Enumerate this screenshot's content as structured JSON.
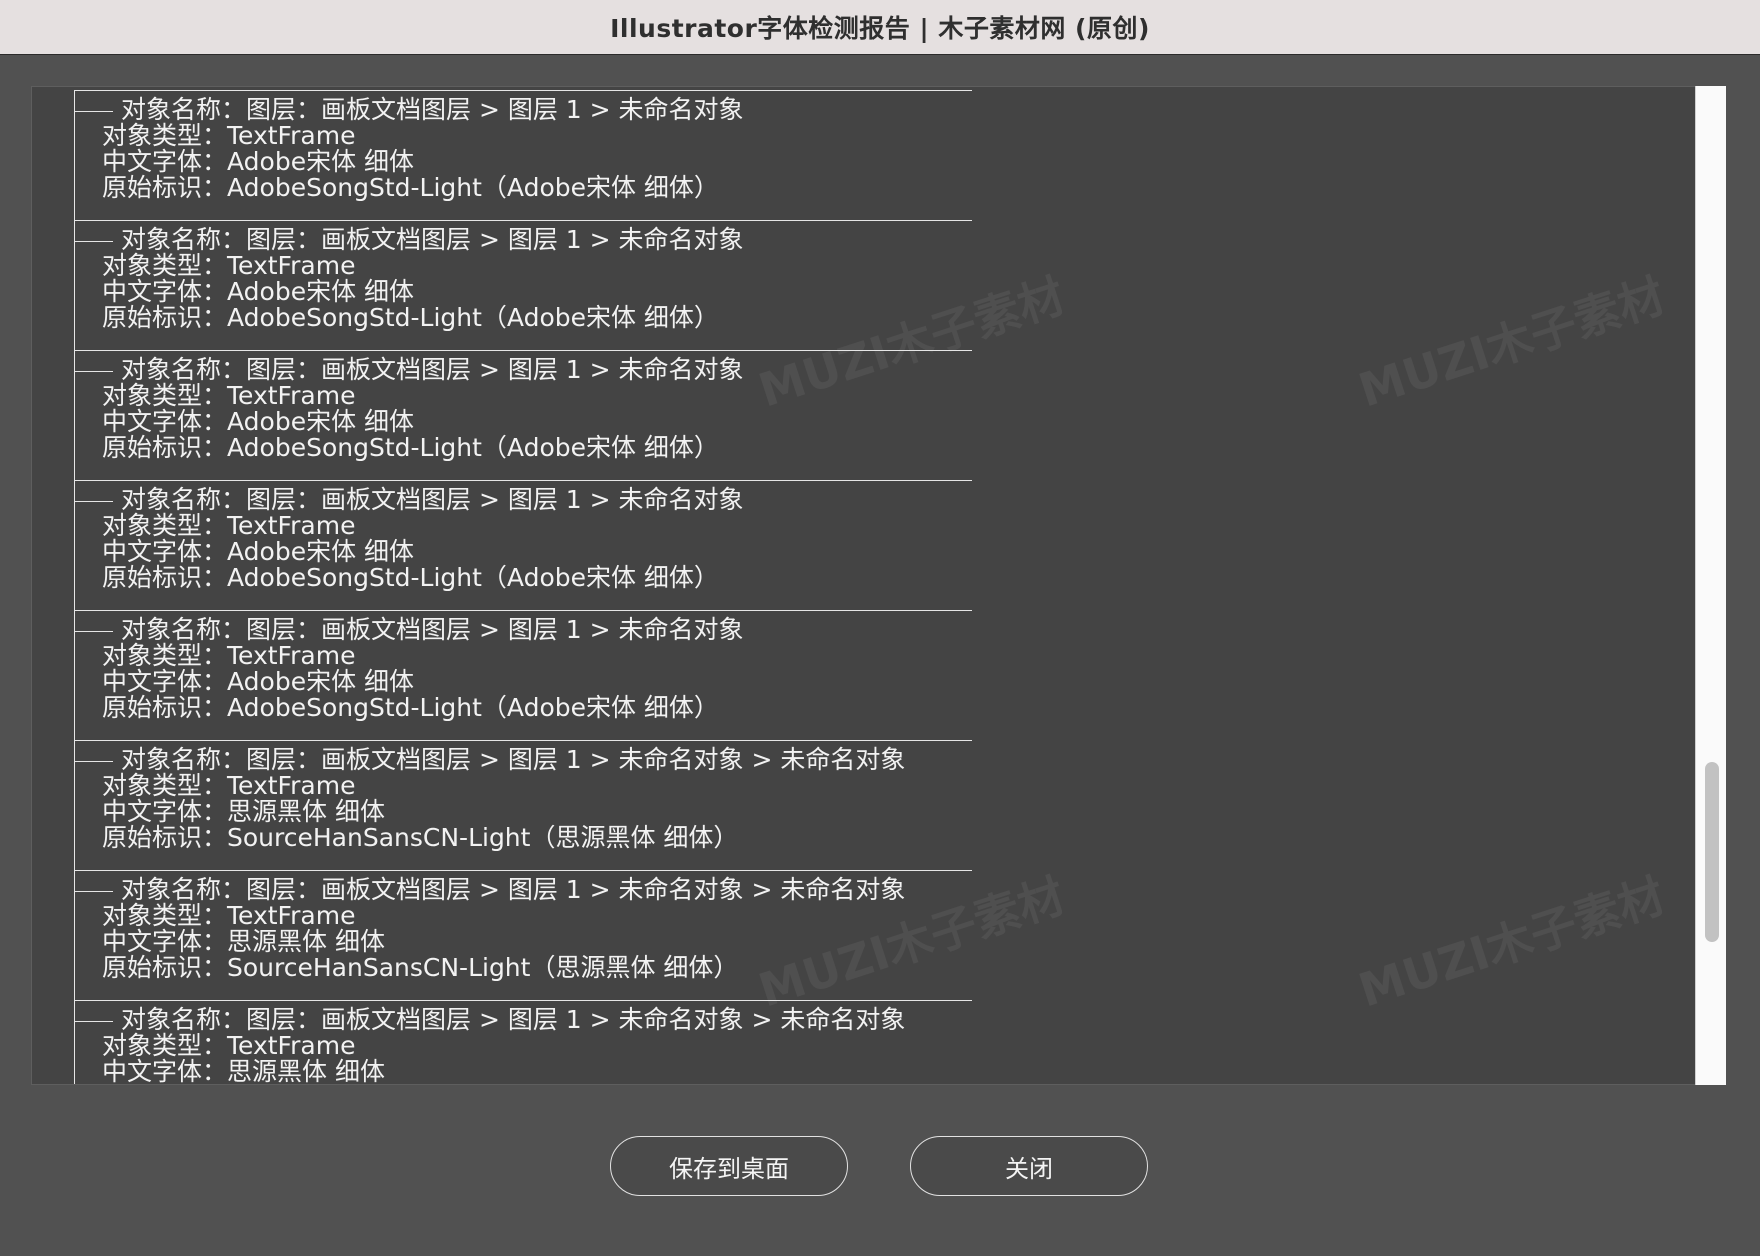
{
  "window": {
    "title": "Illustrator字体检测报告 | 木子素材网 (原创)"
  },
  "report": {
    "entries": [
      {
        "name": "对象名称：图层：画板文档图层 > 图层 1 > 未命名对象",
        "type": "对象类型：TextFrame",
        "font": "中文字体：Adobe宋体 细体",
        "id": "原始标识：AdobeSongStd-Light（Adobe宋体 细体）"
      },
      {
        "name": "对象名称：图层：画板文档图层 > 图层 1 > 未命名对象",
        "type": "对象类型：TextFrame",
        "font": "中文字体：Adobe宋体 细体",
        "id": "原始标识：AdobeSongStd-Light（Adobe宋体 细体）"
      },
      {
        "name": "对象名称：图层：画板文档图层 > 图层 1 > 未命名对象",
        "type": "对象类型：TextFrame",
        "font": "中文字体：Adobe宋体 细体",
        "id": "原始标识：AdobeSongStd-Light（Adobe宋体 细体）"
      },
      {
        "name": "对象名称：图层：画板文档图层 > 图层 1 > 未命名对象",
        "type": "对象类型：TextFrame",
        "font": "中文字体：Adobe宋体 细体",
        "id": "原始标识：AdobeSongStd-Light（Adobe宋体 细体）"
      },
      {
        "name": "对象名称：图层：画板文档图层 > 图层 1 > 未命名对象",
        "type": "对象类型：TextFrame",
        "font": "中文字体：Adobe宋体 细体",
        "id": "原始标识：AdobeSongStd-Light（Adobe宋体 细体）"
      },
      {
        "name": "对象名称：图层：画板文档图层 > 图层 1 > 未命名对象 > 未命名对象",
        "type": "对象类型：TextFrame",
        "font": "中文字体：思源黑体 细体",
        "id": "原始标识：SourceHanSansCN-Light（思源黑体 细体）"
      },
      {
        "name": "对象名称：图层：画板文档图层 > 图层 1 > 未命名对象 > 未命名对象",
        "type": "对象类型：TextFrame",
        "font": "中文字体：思源黑体 细体",
        "id": "原始标识：SourceHanSansCN-Light（思源黑体 细体）"
      },
      {
        "name": "对象名称：图层：画板文档图层 > 图层 1 > 未命名对象 > 未命名对象",
        "type": "对象类型：TextFrame",
        "font": "中文字体：思源黑体 细体",
        "id": ""
      }
    ]
  },
  "watermark_text": "MUZI木子素材",
  "buttons": {
    "save_label": "保存到桌面",
    "close_label": "关闭"
  }
}
